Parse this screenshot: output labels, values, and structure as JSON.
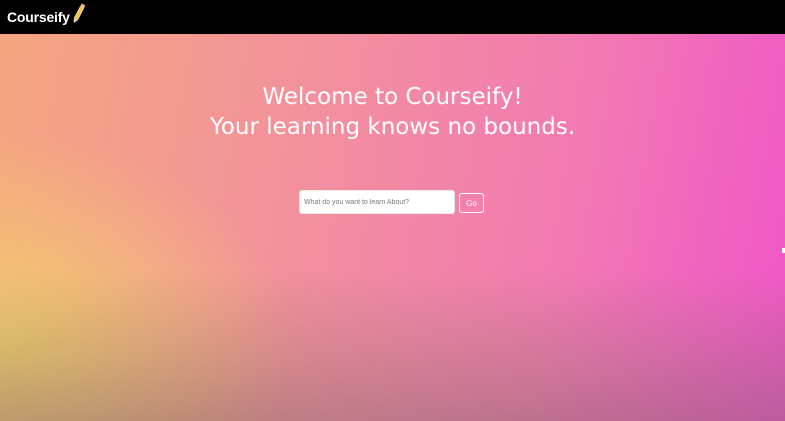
{
  "navbar": {
    "brand": "Courseify",
    "brand_icon": "pencil-icon"
  },
  "hero": {
    "headline_line1": "Welcome to Courseify!",
    "headline_line2": "Your learning knows no bounds.",
    "search": {
      "placeholder": "What do you want to learn About?",
      "value": ""
    },
    "go_label": "Go"
  },
  "colors": {
    "navbar_bg": "#000000",
    "gradient_left": "#f4a77f",
    "gradient_mid": "#f38f9e",
    "gradient_right": "#ef55c9",
    "gradient_bottom_left": "#f2ce6e",
    "text": "#ffffff"
  }
}
